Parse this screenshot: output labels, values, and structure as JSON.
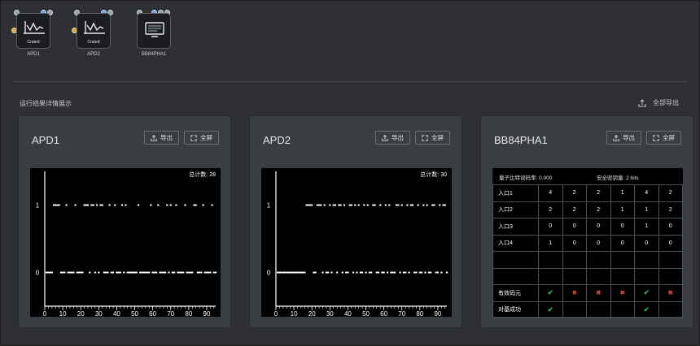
{
  "devices": [
    {
      "tile_label": "Crated",
      "caption": "APD1",
      "icon": "waveform-icon"
    },
    {
      "tile_label": "Crated",
      "caption": "APD2",
      "icon": "waveform-icon"
    },
    {
      "tile_label": "",
      "caption": "BB84PHA1",
      "icon": "monitor-icon"
    }
  ],
  "section_title": "运行结果详情展示",
  "export_all_label": "全部导出",
  "buttons": {
    "export": "导出",
    "fullscreen": "全屏"
  },
  "cards": [
    {
      "title": "APD1",
      "counter_label": "总计数:",
      "counter_value": "28",
      "chart_data": {
        "type": "scatter",
        "title": "",
        "xlabel": "",
        "ylabel": "",
        "xlim": [
          0,
          95
        ],
        "ylim": [
          -0.5,
          1.5
        ],
        "x_ticks": [
          0,
          10,
          20,
          30,
          40,
          50,
          60,
          70,
          80,
          90
        ],
        "y_ticks": [
          0,
          1
        ],
        "series": [
          {
            "x": [
              1,
              2,
              3,
              4,
              5,
              6,
              7,
              8,
              9,
              10,
              11,
              12,
              13,
              14,
              15,
              16,
              17,
              18,
              19,
              20,
              21,
              22,
              23,
              24,
              25,
              26,
              27,
              28,
              29,
              30,
              31,
              32,
              33,
              34,
              35,
              36,
              37,
              38,
              39,
              40,
              41,
              42,
              43,
              44,
              45,
              46,
              47,
              48,
              49,
              50,
              51,
              52,
              53,
              54,
              55,
              56,
              57,
              58,
              59,
              60,
              61,
              62,
              63,
              64,
              65,
              66,
              67,
              68,
              69,
              70,
              71,
              72,
              73,
              74,
              75,
              76,
              77,
              78,
              79,
              80,
              81,
              82,
              83,
              84,
              85,
              86,
              87,
              88,
              89,
              90,
              91,
              92,
              93,
              94,
              95
            ],
            "y": [
              0,
              0,
              0,
              0,
              1,
              1,
              1,
              1,
              0,
              0,
              0,
              1,
              0,
              0,
              0,
              0,
              1,
              0,
              0,
              0,
              0,
              1,
              1,
              1,
              0,
              1,
              1,
              0,
              1,
              0,
              1,
              1,
              0,
              0,
              0,
              1,
              0,
              0,
              1,
              0,
              0,
              0,
              1,
              0,
              1,
              0,
              0,
              0,
              0,
              0,
              0,
              1,
              0,
              0,
              0,
              0,
              0,
              0,
              1,
              0,
              0,
              0,
              1,
              0,
              0,
              0,
              0,
              1,
              0,
              1,
              0,
              0,
              1,
              0,
              0,
              0,
              0,
              1,
              0,
              0,
              0,
              0,
              1,
              1,
              0,
              0,
              0,
              1,
              0,
              0,
              0,
              0,
              1,
              0,
              0
            ]
          }
        ]
      }
    },
    {
      "title": "APD2",
      "counter_label": "总计数:",
      "counter_value": "30",
      "chart_data": {
        "type": "scatter",
        "title": "",
        "xlabel": "",
        "ylabel": "",
        "xlim": [
          0,
          95
        ],
        "ylim": [
          -0.5,
          1.5
        ],
        "x_ticks": [
          0,
          10,
          20,
          30,
          40,
          50,
          60,
          70,
          80,
          90
        ],
        "y_ticks": [
          0,
          1
        ],
        "series": [
          {
            "x": [
              1,
              2,
              3,
              4,
              5,
              6,
              7,
              8,
              9,
              10,
              11,
              12,
              13,
              14,
              15,
              16,
              17,
              18,
              19,
              20,
              21,
              22,
              23,
              24,
              25,
              26,
              27,
              28,
              29,
              30,
              31,
              32,
              33,
              34,
              35,
              36,
              37,
              38,
              39,
              40,
              41,
              42,
              43,
              44,
              45,
              46,
              47,
              48,
              49,
              50,
              51,
              52,
              53,
              54,
              55,
              56,
              57,
              58,
              59,
              60,
              61,
              62,
              63,
              64,
              65,
              66,
              67,
              68,
              69,
              70,
              71,
              72,
              73,
              74,
              75,
              76,
              77,
              78,
              79,
              80,
              81,
              82,
              83,
              84,
              85,
              86,
              87,
              88,
              89,
              90,
              91,
              92,
              93,
              94,
              95
            ],
            "y": [
              0,
              0,
              0,
              0,
              0,
              0,
              0,
              0,
              0,
              0,
              0,
              0,
              0,
              0,
              0,
              0,
              1,
              1,
              1,
              1,
              0,
              0,
              1,
              1,
              1,
              0,
              1,
              0,
              0,
              1,
              0,
              1,
              1,
              0,
              1,
              1,
              0,
              1,
              0,
              0,
              1,
              1,
              0,
              1,
              0,
              1,
              0,
              0,
              1,
              0,
              1,
              0,
              0,
              1,
              1,
              0,
              0,
              1,
              0,
              0,
              1,
              0,
              1,
              0,
              0,
              0,
              1,
              1,
              0,
              1,
              0,
              0,
              1,
              0,
              1,
              1,
              0,
              0,
              1,
              0,
              0,
              1,
              0,
              1,
              0,
              0,
              1,
              1,
              0,
              0,
              1,
              0,
              1,
              1,
              0
            ]
          }
        ]
      }
    }
  ],
  "table_card": {
    "title": "BB84PHA1",
    "info_left": "量子比特误码率: 0.000",
    "info_right": "安全密钥量: 2 bits",
    "rows": [
      {
        "label": "入口1",
        "cells": [
          "4",
          "2",
          "2",
          "1",
          "4",
          "2"
        ]
      },
      {
        "label": "入口2",
        "cells": [
          "2",
          "2",
          "2",
          "1",
          "1",
          "2"
        ]
      },
      {
        "label": "入口3",
        "cells": [
          "0",
          "0",
          "0",
          "0",
          "1",
          "0"
        ]
      },
      {
        "label": "入口4",
        "cells": [
          "1",
          "0",
          "0",
          "0",
          "0",
          "0"
        ]
      },
      {
        "label": "",
        "cells": [
          "",
          "",
          "",
          "",
          "",
          ""
        ]
      },
      {
        "label": "",
        "cells": [
          "",
          "",
          "",
          "",
          "",
          ""
        ]
      },
      {
        "label": "有效码元",
        "cells": [
          "check",
          "cross",
          "cross",
          "cross",
          "check",
          "cross"
        ]
      },
      {
        "label": "对基成功",
        "cells": [
          "check",
          "",
          "",
          "",
          "check",
          ""
        ]
      }
    ]
  }
}
